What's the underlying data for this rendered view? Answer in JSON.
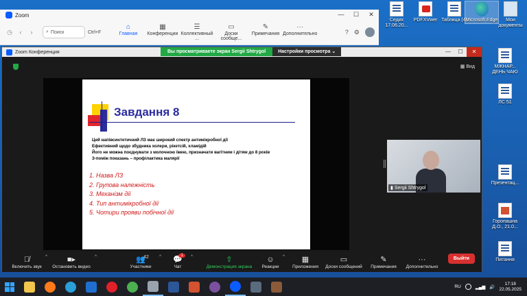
{
  "desktop": {
    "icons_top": [
      {
        "label": "Седих 17.06.20...",
        "kind": "doc"
      },
      {
        "label": "PDFXVwer",
        "kind": "pdf"
      },
      {
        "label": "Таблица (4)",
        "kind": "doc"
      },
      {
        "label": "Microsoft Edge",
        "kind": "edge"
      },
      {
        "label": "Мои документы",
        "kind": "pc"
      }
    ],
    "icons_right": [
      {
        "label": "МЖНАР... ДЕНЬ ЧАЮ",
        "kind": "doc"
      },
      {
        "label": "ЛС 51",
        "kind": "doc"
      },
      {
        "label": "Презентац...",
        "kind": "doc"
      },
      {
        "label": "Горопашна Д.О., 21.0...",
        "kind": "ppt"
      },
      {
        "label": "Питання",
        "kind": "doc"
      }
    ]
  },
  "zoom_main": {
    "title": "Zoom",
    "search_label": "Поиск",
    "shortcut": "Ctrl+F",
    "tabs": [
      {
        "label": "Главная",
        "icon": "home-icon",
        "glyph": "⌂"
      },
      {
        "label": "Конференции",
        "icon": "calendar-icon",
        "glyph": "▦"
      },
      {
        "label": "Коллективный ...",
        "icon": "chat-icon",
        "glyph": "☰"
      },
      {
        "label": "Доски сообще...",
        "icon": "whiteboard-icon",
        "glyph": "▭"
      },
      {
        "label": "Примечания",
        "icon": "notes-icon",
        "glyph": "✎"
      },
      {
        "label": "Дополнительно",
        "icon": "more-icon",
        "glyph": "···"
      }
    ]
  },
  "conference": {
    "title": "Zoom Конференция",
    "share_notice": "Вы просматриваете экран Sergii Shtrygol",
    "view_settings": "Настройки просмотра",
    "view_label": "Вид",
    "slide": {
      "title": "Завдання 8",
      "lines": [
        "Цей напівсинтетичний ЛЗ має широкий спектр антимікробної дії",
        "Ефективний щодо збудника холери, рікетсій, хламідій",
        "Його не можна поєднувати з молочною їжею, призначати вагітним і дітям до 8 років",
        "З-поміж показань – профілактика малярії"
      ],
      "questions": [
        "1.   Назва ЛЗ",
        "2.   Групова належність",
        "3.   Механізм дії",
        "4.   Тип антимікробної дії",
        "5.   Чотири прояви побічної дії"
      ]
    },
    "participant_name": "Sergii Shtrygol",
    "controls": {
      "mic": "Включить звук",
      "video": "Остановить видео",
      "participants": "Участники",
      "participants_count": "42",
      "chat": "Чат",
      "chat_badge": "1",
      "share": "Демонстрация экрана",
      "reactions": "Реакции",
      "apps": "Приложения",
      "whiteboards": "Доски сообщений",
      "notes": "Примечания",
      "more": "Дополнительно",
      "leave": "Выйти"
    }
  },
  "taskbar": {
    "apps": [
      {
        "name": "file-explorer-icon",
        "color": "#f2c64b"
      },
      {
        "name": "firefox-icon",
        "color": "#ff7a1a"
      },
      {
        "name": "edge-icon",
        "color": "#2a9fd8"
      },
      {
        "name": "ie-icon",
        "color": "#1f6fd0"
      },
      {
        "name": "opera-icon",
        "color": "#e0212a"
      },
      {
        "name": "chrome-icon",
        "color": "#4caf50"
      },
      {
        "name": "settings-icon",
        "color": "#9aa3ad"
      },
      {
        "name": "word-icon",
        "color": "#2b5797"
      },
      {
        "name": "powerpoint-icon",
        "color": "#d35230"
      },
      {
        "name": "viber-icon",
        "color": "#7b519d"
      },
      {
        "name": "zoom-icon",
        "color": "#0b5cff"
      },
      {
        "name": "app-icon",
        "color": "#5a6b7d"
      },
      {
        "name": "app2-icon",
        "color": "#8a5a3a"
      }
    ],
    "language": "RU",
    "time": "17:18",
    "date": "22.05.2025"
  }
}
